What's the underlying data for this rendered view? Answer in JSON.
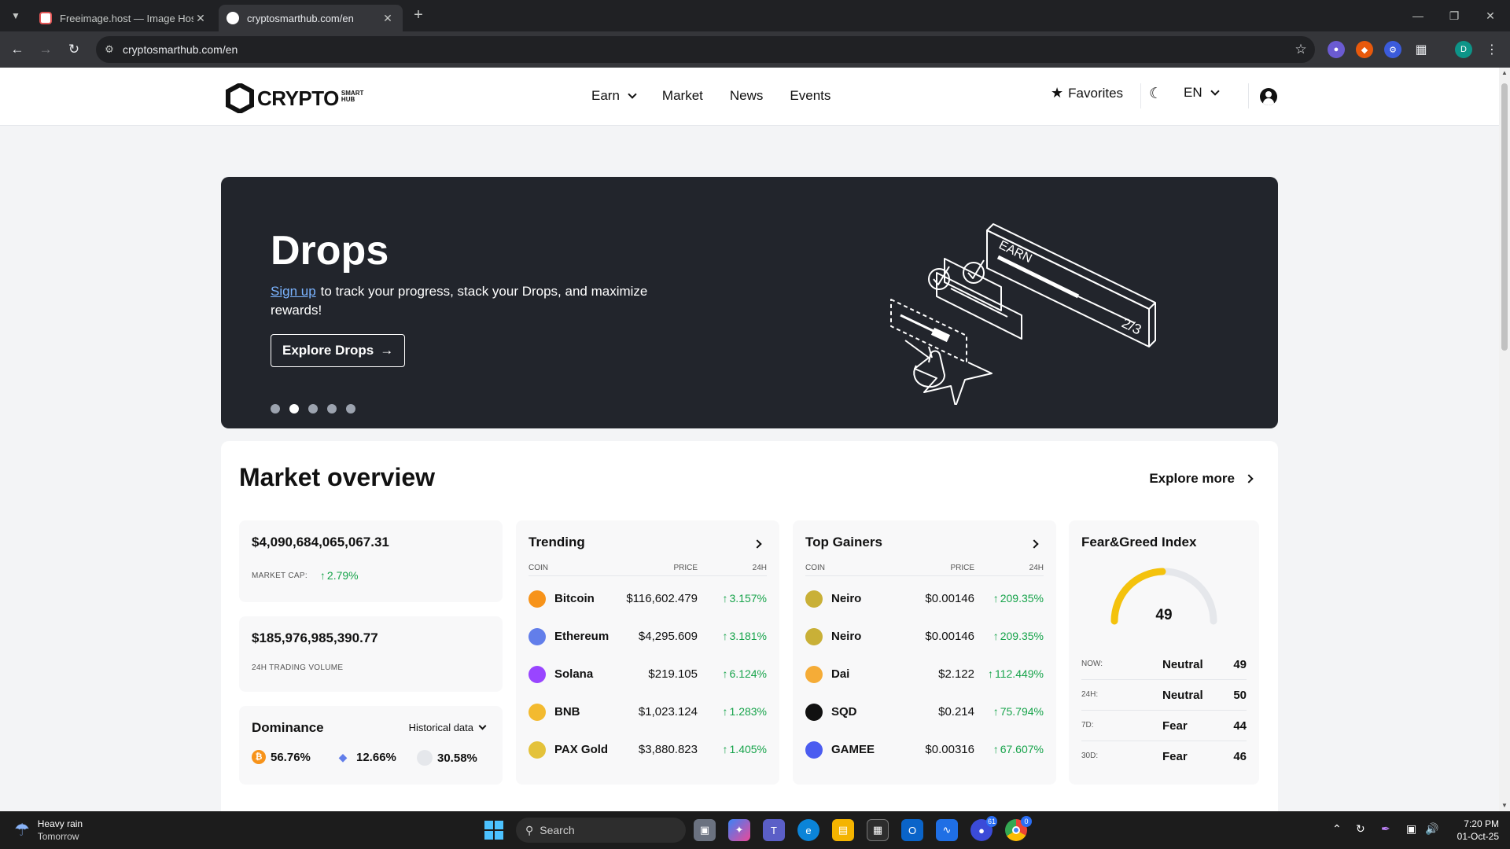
{
  "browser": {
    "tabs": [
      {
        "title": "Freeimage.host — Image Hosting",
        "active": false
      },
      {
        "title": "cryptosmarthub.com/en",
        "active": true
      }
    ],
    "url": "cryptosmarthub.com/en",
    "profile_initial": "D"
  },
  "site": {
    "logo_word": "CRYPTO",
    "logo_sub_top": "SMART",
    "logo_sub_bottom": "HUB",
    "nav": {
      "earn": "Earn",
      "market": "Market",
      "news": "News",
      "events": "Events"
    },
    "favorites": "Favorites",
    "language": "EN"
  },
  "hero": {
    "title": "Drops",
    "signup_link": "Sign up",
    "description": "to track your progress, stack your Drops, and maximize rewards!",
    "cta": "Explore Drops",
    "slides": 5,
    "active_slide": 2,
    "art_text_earn": "EARN",
    "art_text_progress": "2/3"
  },
  "overview": {
    "title": "Market overview",
    "explore_more": "Explore more",
    "market_cap": {
      "value": "$4,090,684,065,067.31",
      "label": "MARKET CAP:",
      "change": "2.79%"
    },
    "volume": {
      "value": "$185,976,985,390.77",
      "label": "24H TRADING VOLUME"
    },
    "dominance": {
      "title": "Dominance",
      "historical": "Historical data",
      "btc": "56.76%",
      "eth": "12.66%",
      "other": "30.58%"
    },
    "trending": {
      "title": "Trending",
      "headers": {
        "coin": "COIN",
        "price": "PRICE",
        "change": "24H"
      },
      "rows": [
        {
          "name": "Bitcoin",
          "price": "$116,602.479",
          "change": "3.157%",
          "icon": "bitcoin-icon",
          "color": "#f7931a"
        },
        {
          "name": "Ethereum",
          "price": "$4,295.609",
          "change": "3.181%",
          "icon": "ethereum-icon",
          "color": "#627eea"
        },
        {
          "name": "Solana",
          "price": "$219.105",
          "change": "6.124%",
          "icon": "solana-icon",
          "color": "#9945ff"
        },
        {
          "name": "BNB",
          "price": "$1,023.124",
          "change": "1.283%",
          "icon": "bnb-icon",
          "color": "#f3ba2f"
        },
        {
          "name": "PAX Gold",
          "price": "$3,880.823",
          "change": "1.405%",
          "icon": "pax-gold-icon",
          "color": "#e4c23a"
        }
      ]
    },
    "gainers": {
      "title": "Top Gainers",
      "headers": {
        "coin": "COIN",
        "price": "PRICE",
        "change": "24H"
      },
      "rows": [
        {
          "name": "Neiro",
          "price": "$0.00146",
          "change": "209.35%",
          "icon": "neiro-icon",
          "color": "#c9b037"
        },
        {
          "name": "Neiro",
          "price": "$0.00146",
          "change": "209.35%",
          "icon": "neiro-icon",
          "color": "#c9b037"
        },
        {
          "name": "Dai",
          "price": "$2.122",
          "change": "112.449%",
          "icon": "dai-icon",
          "color": "#f5ac37"
        },
        {
          "name": "SQD",
          "price": "$0.214",
          "change": "75.794%",
          "icon": "sqd-icon",
          "color": "#111111"
        },
        {
          "name": "GAMEE",
          "price": "$0.00316",
          "change": "67.607%",
          "icon": "gamee-icon",
          "color": "#4b5cf0"
        }
      ]
    },
    "fear_greed": {
      "title": "Fear&Greed Index",
      "value": "49",
      "level_fraction": 0.49,
      "rows": [
        {
          "key": "NOW:",
          "state": "Neutral",
          "value": "49"
        },
        {
          "key": "24H:",
          "state": "Neutral",
          "value": "50"
        },
        {
          "key": "7D:",
          "state": "Fear",
          "value": "44"
        },
        {
          "key": "30D:",
          "state": "Fear",
          "value": "46"
        }
      ]
    }
  },
  "taskbar": {
    "weather_title": "Heavy rain",
    "weather_sub": "Tomorrow",
    "search": "Search",
    "badge_1": "61",
    "badge_2": "0",
    "time": "7:20 PM",
    "date": "01-Oct-25"
  },
  "colors": {
    "accent_green": "#16a34a",
    "hero_bg": "#22252c",
    "gauge": "#f4c20d"
  }
}
